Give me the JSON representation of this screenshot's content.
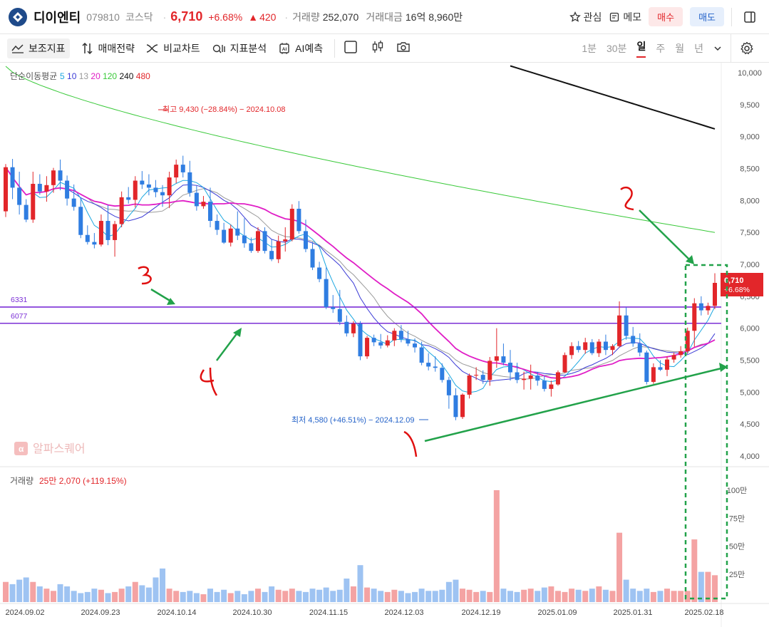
{
  "header": {
    "stock_name": "디이엔티",
    "stock_code": "079810",
    "market": "코스닥",
    "price": "6,710",
    "change_pct": "+6.68%",
    "change_amount": "420",
    "volume_label": "거래량",
    "volume_value": "252,070",
    "amount_label": "거래대금",
    "amount_value": "16억 8,960만",
    "watch_label": "관심",
    "memo_label": "메모",
    "buy_label": "매수",
    "sell_label": "매도"
  },
  "toolbar": {
    "indicator_label": "보조지표",
    "strategy_label": "매매전략",
    "compare_label": "비교차트",
    "analysis_label": "지표분석",
    "ai_label": "AI예측",
    "periods": [
      "1분",
      "30분",
      "일",
      "주",
      "월",
      "년"
    ],
    "active_period": "일"
  },
  "chart_data": {
    "type": "candlestick",
    "ma_legend": {
      "title": "단순이동평균",
      "periods": [
        "5",
        "10",
        "13",
        "20",
        "120",
        "240",
        "480"
      ],
      "colors": [
        "#1ca7e0",
        "#3b3bd6",
        "#9a9a9a",
        "#e01ec6",
        "#39c939",
        "#111111",
        "#e2262a"
      ]
    },
    "y_ticks": [
      "10,000",
      "9,500",
      "9,000",
      "8,500",
      "8,000",
      "7,500",
      "7,000",
      "6,500",
      "6,000",
      "5,500",
      "5,000",
      "4,500",
      "4,000"
    ],
    "ylim": [
      4000,
      10000
    ],
    "x_ticks": [
      "2024.09.02",
      "2024.09.23",
      "2024.10.14",
      "2024.10.30",
      "2024.11.15",
      "2024.12.03",
      "2024.12.19",
      "2025.01.09",
      "2025.01.31",
      "2025.02.18"
    ],
    "high_note": "최고 9,430 (−28.84%) − 2024.10.08",
    "low_note": "최저 4,580 (+46.51%) − 2024.12.09",
    "levels": [
      {
        "label": "6331",
        "value": 6331,
        "color": "#7b2fd6"
      },
      {
        "label": "6077",
        "value": 6077,
        "color": "#7b2fd6"
      }
    ],
    "last_price_badge": {
      "price": "6,710",
      "pct": "+6.68%"
    },
    "watermark": "알파스퀘어",
    "annotations": [
      "1",
      "2",
      "3",
      "4"
    ],
    "candles": [
      [
        7830,
        8570,
        7740,
        8520
      ],
      [
        8520,
        8650,
        8020,
        8200
      ],
      [
        8200,
        8450,
        7780,
        7930
      ],
      [
        7930,
        8020,
        7660,
        7700
      ],
      [
        7700,
        8450,
        7650,
        8260
      ],
      [
        8260,
        8410,
        8090,
        8140
      ],
      [
        8140,
        8380,
        7980,
        8240
      ],
      [
        8240,
        8510,
        8120,
        8470
      ],
      [
        8470,
        8640,
        8160,
        8310
      ],
      [
        8310,
        8390,
        7920,
        8030
      ],
      [
        8030,
        8250,
        7840,
        7900
      ],
      [
        7900,
        8050,
        7410,
        7460
      ],
      [
        7460,
        7610,
        7310,
        7350
      ],
      [
        7350,
        7490,
        7250,
        7310
      ],
      [
        7310,
        7780,
        7280,
        7680
      ],
      [
        7680,
        7930,
        7300,
        7380
      ],
      [
        7380,
        7680,
        7120,
        7630
      ],
      [
        7630,
        8140,
        7580,
        8050
      ],
      [
        8050,
        8210,
        7950,
        8010
      ],
      [
        8010,
        8380,
        7890,
        8310
      ],
      [
        8310,
        8460,
        8180,
        8250
      ],
      [
        8250,
        8410,
        8080,
        8200
      ],
      [
        8200,
        8320,
        8050,
        8130
      ],
      [
        8130,
        8240,
        7900,
        8080
      ],
      [
        8080,
        8450,
        7880,
        8360
      ],
      [
        8360,
        8640,
        8270,
        8560
      ],
      [
        8560,
        8700,
        8360,
        8440
      ],
      [
        8440,
        8620,
        8060,
        8120
      ],
      [
        8120,
        8230,
        7840,
        7910
      ],
      [
        7910,
        8070,
        7870,
        7980
      ],
      [
        7980,
        8200,
        7580,
        7680
      ],
      [
        7680,
        7780,
        7460,
        7540
      ],
      [
        7540,
        7650,
        7320,
        7340
      ],
      [
        7340,
        7620,
        7280,
        7560
      ],
      [
        7560,
        7830,
        7380,
        7450
      ],
      [
        7450,
        7720,
        7260,
        7330
      ],
      [
        7330,
        7420,
        7180,
        7210
      ],
      [
        7210,
        7580,
        7180,
        7520
      ],
      [
        7520,
        7580,
        7170,
        7210
      ],
      [
        7210,
        7390,
        7050,
        7080
      ],
      [
        7080,
        7450,
        7020,
        7360
      ],
      [
        7360,
        7580,
        7200,
        7390
      ],
      [
        7390,
        7940,
        7360,
        7870
      ],
      [
        7870,
        7990,
        7480,
        7520
      ],
      [
        7520,
        7700,
        7190,
        7240
      ],
      [
        7240,
        7350,
        6910,
        6950
      ],
      [
        6950,
        7040,
        6720,
        6770
      ],
      [
        6770,
        6950,
        6300,
        6330
      ],
      [
        6330,
        6520,
        6240,
        6300
      ],
      [
        6300,
        6600,
        6050,
        6100
      ],
      [
        6100,
        6200,
        5870,
        5920
      ],
      [
        5920,
        6110,
        5860,
        6070
      ],
      [
        6070,
        6110,
        5500,
        5560
      ],
      [
        5560,
        5880,
        5520,
        5850
      ],
      [
        5850,
        5900,
        5720,
        5780
      ],
      [
        5780,
        5910,
        5680,
        5730
      ],
      [
        5730,
        5890,
        5700,
        5810
      ],
      [
        5810,
        6000,
        5720,
        5960
      ],
      [
        5960,
        6050,
        5780,
        5830
      ],
      [
        5830,
        5960,
        5720,
        5760
      ],
      [
        5760,
        5840,
        5620,
        5700
      ],
      [
        5700,
        5790,
        5420,
        5460
      ],
      [
        5460,
        5610,
        5340,
        5400
      ],
      [
        5400,
        5560,
        5320,
        5380
      ],
      [
        5380,
        5450,
        5150,
        5190
      ],
      [
        5190,
        5240,
        4740,
        4950
      ],
      [
        4950,
        5060,
        4560,
        4610
      ],
      [
        4610,
        4980,
        4580,
        4960
      ],
      [
        4960,
        5290,
        4900,
        5260
      ],
      [
        5260,
        5390,
        5190,
        5270
      ],
      [
        5270,
        5340,
        5130,
        5190
      ],
      [
        5190,
        5550,
        5100,
        5490
      ],
      [
        5490,
        6000,
        5380,
        5560
      ],
      [
        5560,
        5760,
        5420,
        5460
      ],
      [
        5460,
        5660,
        5180,
        5310
      ],
      [
        5310,
        5460,
        5140,
        5190
      ],
      [
        5190,
        5320,
        5040,
        5210
      ],
      [
        5210,
        5430,
        5040,
        5260
      ],
      [
        5260,
        5310,
        5100,
        5180
      ],
      [
        5180,
        5260,
        5010,
        5050
      ],
      [
        5050,
        5180,
        4930,
        5120
      ],
      [
        5120,
        5340,
        5100,
        5310
      ],
      [
        5310,
        5620,
        5300,
        5580
      ],
      [
        5580,
        5780,
        5520,
        5720
      ],
      [
        5720,
        5800,
        5620,
        5660
      ],
      [
        5660,
        5850,
        5600,
        5780
      ],
      [
        5780,
        5830,
        5580,
        5610
      ],
      [
        5610,
        5830,
        5550,
        5790
      ],
      [
        5790,
        5900,
        5580,
        5660
      ],
      [
        5660,
        5750,
        5580,
        5720
      ],
      [
        5720,
        6420,
        5700,
        6200
      ],
      [
        6200,
        6330,
        5820,
        5880
      ],
      [
        5880,
        6020,
        5710,
        5760
      ],
      [
        5760,
        5920,
        5560,
        5620
      ],
      [
        5620,
        5650,
        5120,
        5160
      ],
      [
        5160,
        5450,
        5130,
        5390
      ],
      [
        5390,
        5500,
        5330,
        5350
      ],
      [
        5350,
        5560,
        5250,
        5510
      ],
      [
        5510,
        5620,
        5460,
        5580
      ],
      [
        5580,
        5720,
        5540,
        5640
      ],
      [
        5640,
        6010,
        5600,
        5960
      ],
      [
        5960,
        6470,
        5710,
        6390
      ],
      [
        6390,
        6500,
        6200,
        6280
      ],
      [
        6280,
        6400,
        6210,
        6350
      ],
      [
        6350,
        6860,
        6300,
        6710
      ]
    ],
    "volume": {
      "label": "거래량",
      "value_text": "25만 2,070 (+119.15%)",
      "y_ticks": [
        "100만",
        "75만",
        "50만",
        "25만"
      ],
      "values": [
        18,
        16,
        20,
        22,
        18,
        14,
        12,
        10,
        16,
        14,
        10,
        8,
        9,
        12,
        11,
        8,
        9,
        12,
        14,
        18,
        15,
        13,
        22,
        30,
        12,
        10,
        9,
        10,
        8,
        7,
        12,
        9,
        11,
        8,
        10,
        7,
        10,
        12,
        9,
        14,
        11,
        10,
        12,
        10,
        9,
        12,
        11,
        13,
        10,
        11,
        21,
        14,
        33,
        13,
        12,
        10,
        9,
        11,
        10,
        8,
        9,
        12,
        10,
        10,
        11,
        18,
        20,
        12,
        11,
        9,
        10,
        9,
        100,
        12,
        10,
        9,
        11,
        12,
        10,
        13,
        14,
        10,
        9,
        12,
        11,
        10,
        12,
        14,
        11,
        10,
        62,
        20,
        12,
        10,
        12,
        9,
        10,
        12,
        10,
        10,
        10,
        56,
        27,
        27,
        24
      ]
    }
  }
}
